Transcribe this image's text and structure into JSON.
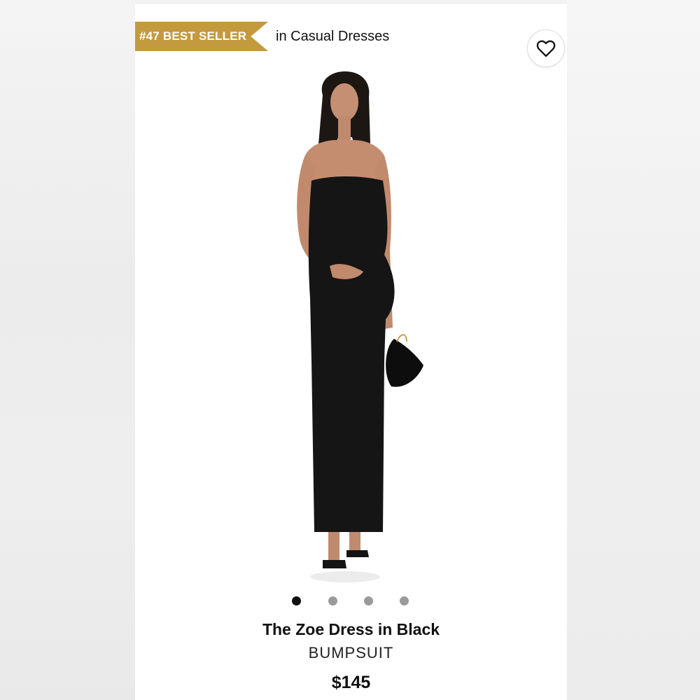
{
  "badge": {
    "rank_label": "#47 BEST SELLER",
    "context_label": "in Casual Dresses",
    "color": "#c39a3e"
  },
  "wishlist": {
    "icon": "heart-icon"
  },
  "product_image": {
    "description_icon": "dress-model-image"
  },
  "carousel": {
    "total": 4,
    "active_index": 0
  },
  "product": {
    "title": "The Zoe Dress in Black",
    "brand": "BUMPSUIT",
    "price": "$145"
  }
}
